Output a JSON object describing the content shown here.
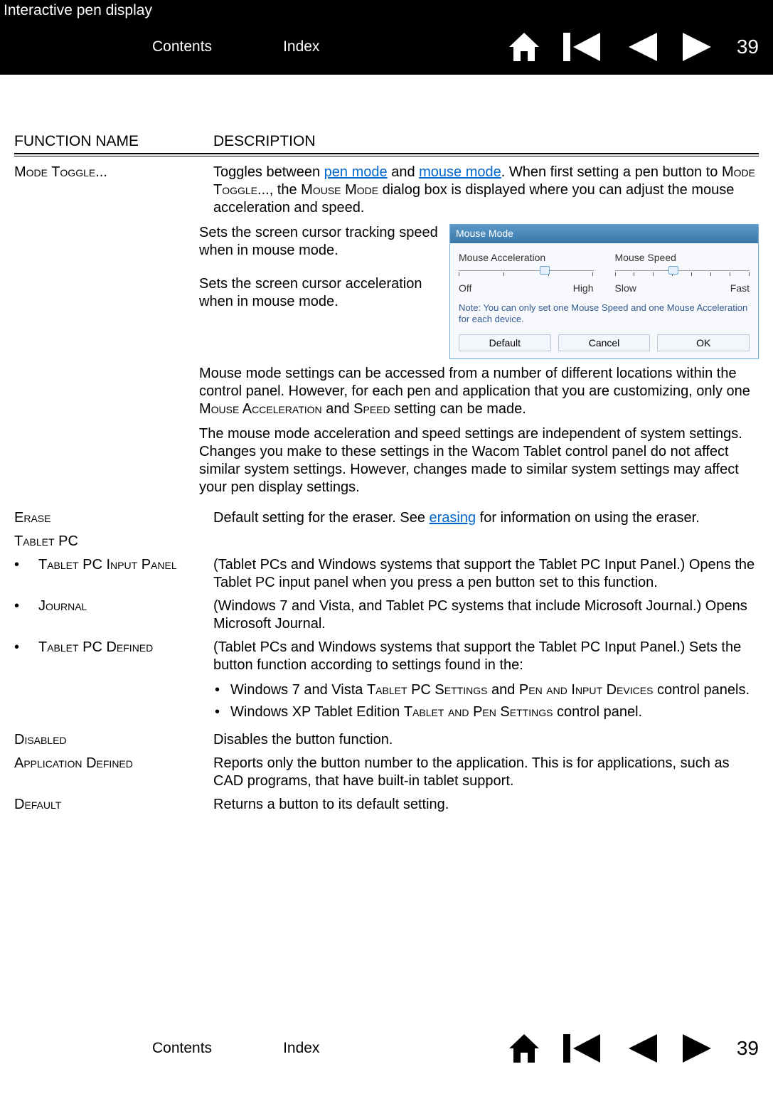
{
  "header": {
    "doc_title": "Interactive pen display",
    "contents": "Contents",
    "index": "Index",
    "page": "39"
  },
  "columns": {
    "fn": "FUNCTION NAME",
    "desc": "DESCRIPTION"
  },
  "mode_toggle": {
    "name": "Mode Toggle...",
    "desc_pre": "Toggles between ",
    "link_pen": "pen mode",
    "desc_mid1": " and ",
    "link_mouse": "mouse mode",
    "desc_mid2": ".  When first setting a pen button to ",
    "sc_mode_toggle": "Mode Toggle...",
    "desc_mid3": ", the ",
    "sc_mouse_mode": "Mouse Mode",
    "desc_end": " dialog box is displayed where you can adjust the mouse acceleration and speed.",
    "callout1": "Sets the screen cursor tracking speed when in mouse mode.",
    "callout2": "Sets the screen cursor acceleration when in mouse mode.",
    "para1_a": "Mouse mode settings can be accessed from a number of different locations within the control panel.  However, for each pen and application that you are customizing, only one ",
    "sc_mouse_accel": "Mouse Acceleration",
    "para1_b": " and ",
    "sc_speed": "Speed",
    "para1_c": " setting can be made.",
    "para2": "The mouse mode acceleration and speed settings are independent of system settings.  Changes you make to these settings in the Wacom Tablet control panel do not affect similar system settings.  However, changes made to similar system settings may affect your pen display settings."
  },
  "dialog": {
    "title": "Mouse Mode",
    "accel_label": "Mouse Acceleration",
    "speed_label": "Mouse Speed",
    "accel_left": "Off",
    "accel_right": "High",
    "speed_left": "Slow",
    "speed_right": "Fast",
    "note": "Note: You can only set one Mouse Speed and one Mouse Acceleration for each device.",
    "btn_default": "Default",
    "btn_cancel": "Cancel",
    "btn_ok": "OK"
  },
  "erase": {
    "name": "Erase",
    "desc_pre": "Default setting for the eraser.  See ",
    "link": "erasing",
    "desc_post": " for information on using the eraser."
  },
  "tablet_pc": {
    "name": "Tablet PC"
  },
  "tpc_input": {
    "name": "Tablet PC Input Panel",
    "desc": "(Tablet PCs and Windows systems that support the Tablet PC Input Panel.)  Opens the Tablet PC input panel when you press a pen button set to this function."
  },
  "journal": {
    "name": "Journal",
    "desc": "(Windows 7 and Vista, and Tablet PC systems that include Microsoft Journal.)  Opens Microsoft Journal."
  },
  "tpc_defined": {
    "name": "Tablet PC Defined",
    "desc": "(Tablet PCs and Windows systems that support the Tablet PC Input Panel.)  Sets the button function according to settings found in the:",
    "b1_pre": "Windows 7 and Vista ",
    "b1_sc1": "Tablet PC Settings",
    "b1_mid": " and ",
    "b1_sc2": "Pen and Input Devices",
    "b1_post": " control panels.",
    "b2_pre": "Windows XP Tablet Edition ",
    "b2_sc": "Tablet and Pen Settings",
    "b2_post": " control panel."
  },
  "disabled": {
    "name": "Disabled",
    "desc": "Disables the button function."
  },
  "app_defined": {
    "name": "Application Defined",
    "desc": "Reports only the button number to the application.  This is for applications, such as CAD programs, that have built-in tablet support."
  },
  "default": {
    "name": "Default",
    "desc": "Returns a button to its default setting."
  },
  "footer": {
    "contents": "Contents",
    "index": "Index",
    "page": "39"
  }
}
